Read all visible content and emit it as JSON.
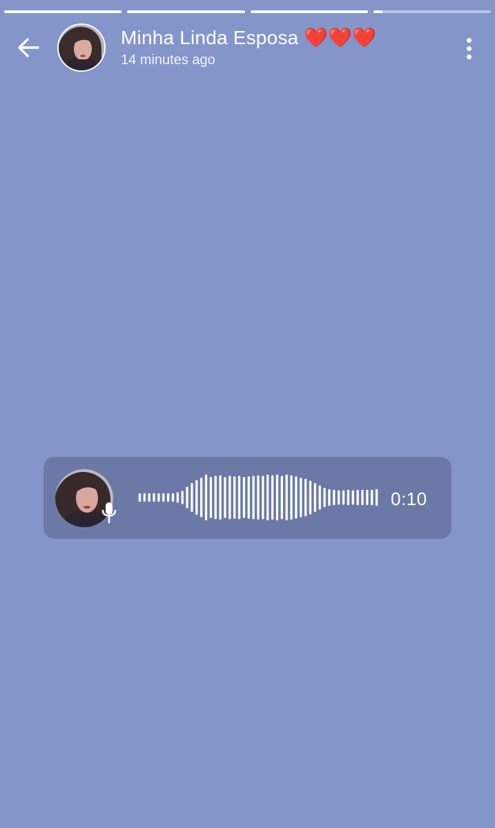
{
  "story": {
    "segments": [
      {
        "progress": 1.0
      },
      {
        "progress": 1.0
      },
      {
        "progress": 1.0
      },
      {
        "progress": 0.08
      }
    ]
  },
  "header": {
    "back_icon": "arrow-left-icon",
    "avatar_icon": "user-avatar",
    "title": "Minha Linda Esposa ❤️❤️❤️",
    "subtitle": "14 minutes ago",
    "more_icon": "more-vertical-icon"
  },
  "voice_message": {
    "avatar_icon": "user-avatar",
    "mic_icon": "microphone-icon",
    "duration": "0:10",
    "waveform_levels": [
      0.18,
      0.18,
      0.18,
      0.18,
      0.18,
      0.18,
      0.18,
      0.18,
      0.22,
      0.28,
      0.45,
      0.6,
      0.72,
      0.82,
      0.95,
      0.85,
      0.9,
      0.92,
      0.85,
      0.9,
      0.88,
      0.9,
      0.85,
      0.88,
      0.9,
      0.92,
      0.9,
      0.95,
      0.92,
      0.95,
      0.9,
      0.95,
      0.92,
      0.88,
      0.82,
      0.78,
      0.7,
      0.6,
      0.5,
      0.4,
      0.35,
      0.32,
      0.3,
      0.3,
      0.32,
      0.3,
      0.32,
      0.32,
      0.32,
      0.32,
      0.35
    ]
  },
  "colors": {
    "background": "#8495ca",
    "card": "#6c79a6",
    "foreground": "#ffffff"
  }
}
